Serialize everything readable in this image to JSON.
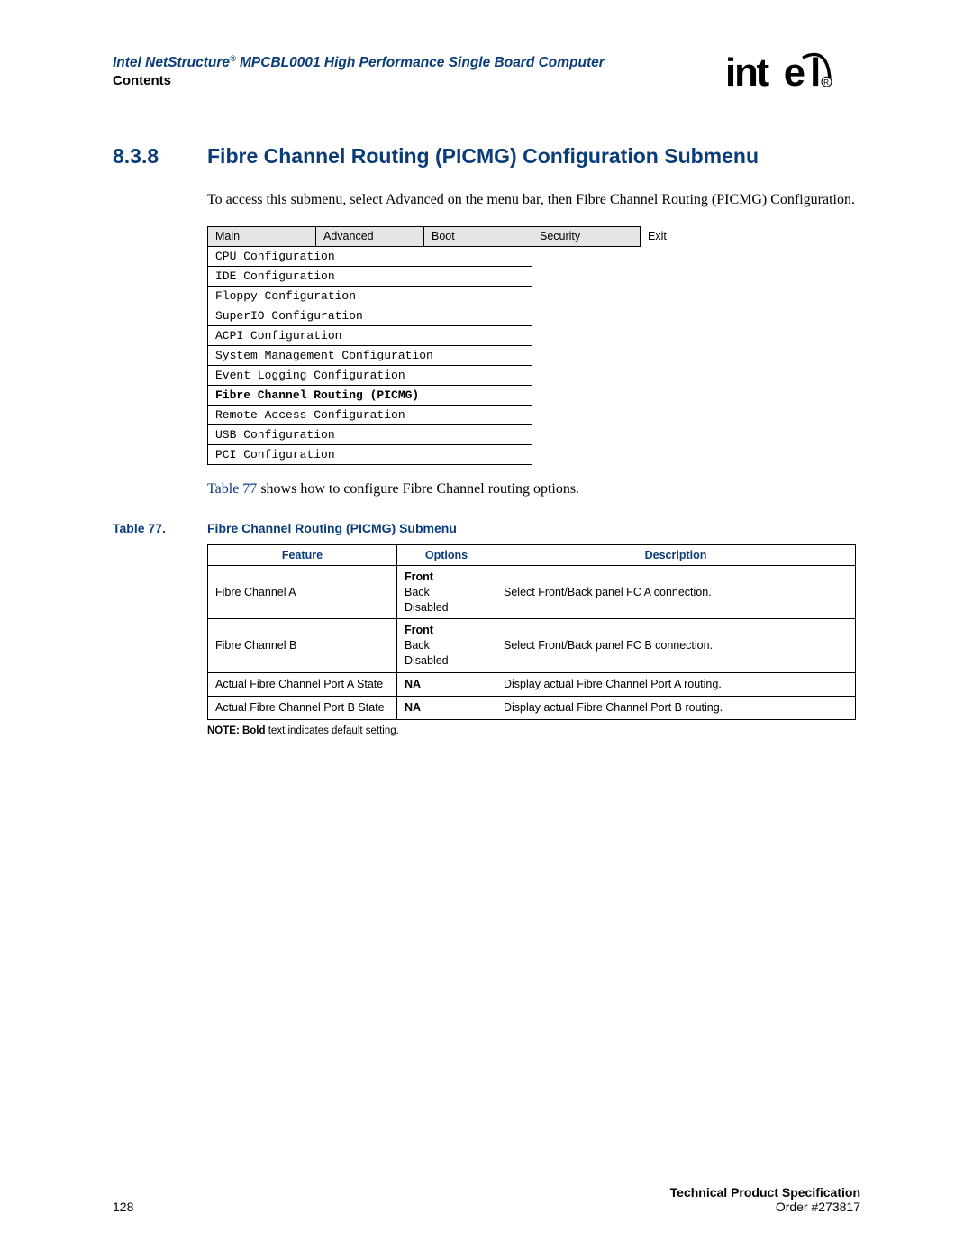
{
  "header": {
    "doc_title_pre": "Intel NetStructure",
    "doc_title_sup": "®",
    "doc_title_post": " MPCBL0001 High Performance Single Board Computer",
    "contents": "Contents"
  },
  "section": {
    "number": "8.3.8",
    "title": "Fibre Channel Routing (PICMG) Configuration Submenu"
  },
  "intro": "To access this submenu, select Advanced on the menu bar, then Fibre Channel Routing (PICMG) Configuration.",
  "menubar": [
    "Main",
    "Advanced",
    "Boot",
    "Security",
    "Exit"
  ],
  "menu_items": [
    {
      "label": "CPU Configuration",
      "bold": false
    },
    {
      "label": "IDE Configuration",
      "bold": false
    },
    {
      "label": "Floppy Configuration",
      "bold": false
    },
    {
      "label": "SuperIO Configuration",
      "bold": false
    },
    {
      "label": "ACPI Configuration",
      "bold": false
    },
    {
      "label": "System Management Configuration",
      "bold": false
    },
    {
      "label": "Event Logging Configuration",
      "bold": false
    },
    {
      "label": "Fibre Channel Routing (PICMG)",
      "bold": true
    },
    {
      "label": "Remote Access Configuration",
      "bold": false
    },
    {
      "label": "USB Configuration",
      "bold": false
    },
    {
      "label": "PCI Configuration",
      "bold": false
    }
  ],
  "table_ref_link": "Table 77",
  "table_ref_rest": " shows how to configure Fibre Channel routing options.",
  "table_caption_label": "Table 77.",
  "table_caption_title": "Fibre Channel Routing (PICMG) Submenu",
  "data_headers": [
    "Feature",
    "Options",
    "Description"
  ],
  "data_rows": [
    {
      "feature": "Fibre Channel A",
      "opt_bold": "Front",
      "opt_rest": "Back\nDisabled",
      "desc": "Select Front/Back panel FC A connection."
    },
    {
      "feature": "Fibre Channel B",
      "opt_bold": "Front",
      "opt_rest": "Back\nDisabled",
      "desc": "Select Front/Back panel FC B connection."
    },
    {
      "feature": "Actual Fibre Channel Port A State",
      "opt_bold": "NA",
      "opt_rest": "",
      "desc": "Display actual Fibre Channel Port A routing."
    },
    {
      "feature": "Actual Fibre Channel Port B State",
      "opt_bold": "NA",
      "opt_rest": "",
      "desc": "Display actual Fibre Channel Port B routing."
    }
  ],
  "note_bold": "NOTE:  Bold",
  "note_rest": " text indicates default setting.",
  "footer": {
    "page": "128",
    "spec": "Technical Product Specification",
    "order": "Order #273817"
  }
}
